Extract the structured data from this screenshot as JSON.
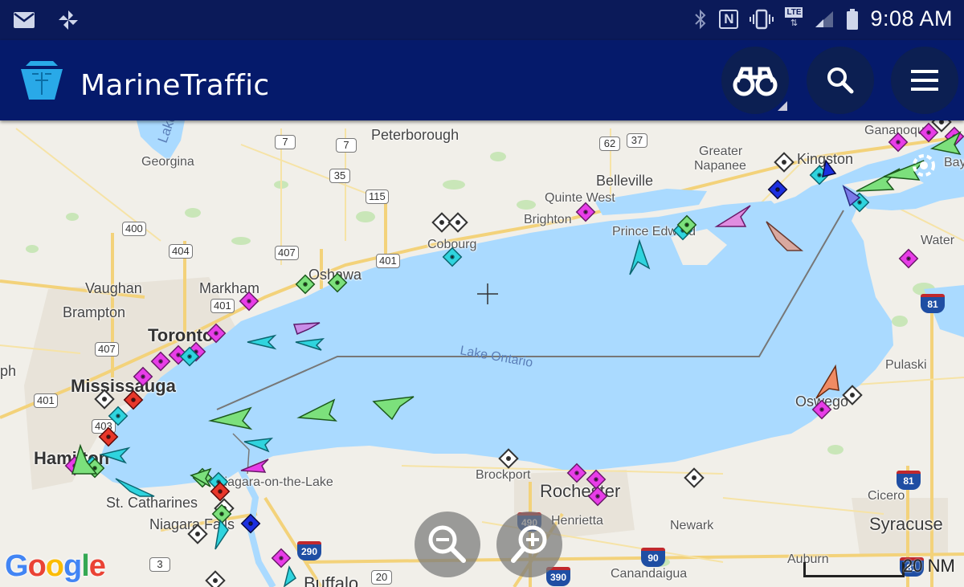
{
  "status_bar": {
    "time": "9:08 AM",
    "network": "LTE",
    "nfc": "N",
    "icons": [
      "mail-icon",
      "pinwheel-icon",
      "bluetooth-icon",
      "nfc-icon",
      "vibrate-icon",
      "lte-icon",
      "signal-icon",
      "battery-icon"
    ]
  },
  "app_bar": {
    "title": "MarineTraffic",
    "buttons": [
      "binoculars-icon",
      "search-icon",
      "menu-icon"
    ]
  },
  "map": {
    "water_body": "Lake Ontario",
    "lake_simcoe_label": "Lake",
    "places": [
      {
        "id": "peterborough",
        "name": "Peterborough"
      },
      {
        "id": "georgina",
        "name": "Georgina"
      },
      {
        "id": "gananoque",
        "name": "Gananoque"
      },
      {
        "id": "kingston",
        "name": "Kingston"
      },
      {
        "id": "bay",
        "name": "Bay"
      },
      {
        "id": "greater-napanee-1",
        "name": "Greater"
      },
      {
        "id": "greater-napanee-2",
        "name": "Napanee"
      },
      {
        "id": "belleville",
        "name": "Belleville"
      },
      {
        "id": "quinte-west",
        "name": "Quinte West"
      },
      {
        "id": "brighton",
        "name": "Brighton"
      },
      {
        "id": "cobourg",
        "name": "Cobourg"
      },
      {
        "id": "prince-edward",
        "name": "Prince Edward"
      },
      {
        "id": "watertown",
        "name": "Water"
      },
      {
        "id": "vaughan",
        "name": "Vaughan"
      },
      {
        "id": "markham",
        "name": "Markham"
      },
      {
        "id": "oshawa",
        "name": "Oshawa"
      },
      {
        "id": "brampton",
        "name": "Brampton"
      },
      {
        "id": "toronto",
        "name": "Toronto"
      },
      {
        "id": "mississauga",
        "name": "Mississauga"
      },
      {
        "id": "ph",
        "name": "ph"
      },
      {
        "id": "hamilton",
        "name": "Hamilton"
      },
      {
        "id": "pulaski",
        "name": "Pulaski"
      },
      {
        "id": "oswego",
        "name": "Oswego"
      },
      {
        "id": "st-catharines",
        "name": "St. Catharines"
      },
      {
        "id": "niagara-falls",
        "name": "Niagara Falls"
      },
      {
        "id": "niagara-on-the-lake",
        "name": "Niagara-on-the-Lake"
      },
      {
        "id": "brockport",
        "name": "Brockport"
      },
      {
        "id": "rochester",
        "name": "Rochester"
      },
      {
        "id": "henrietta",
        "name": "Henrietta"
      },
      {
        "id": "newark",
        "name": "Newark"
      },
      {
        "id": "cicero",
        "name": "Cicero"
      },
      {
        "id": "syracuse",
        "name": "Syracuse"
      },
      {
        "id": "auburn",
        "name": "Auburn"
      },
      {
        "id": "canandaigua",
        "name": "Canandaigua"
      },
      {
        "id": "buffalo",
        "name": "Buffalo"
      }
    ],
    "highway_shields": [
      "7",
      "7",
      "62",
      "37",
      "35",
      "115",
      "400",
      "404",
      "407",
      "401",
      "401",
      "407",
      "401",
      "403"
    ],
    "interstate_shields": [
      "81",
      "81",
      "490",
      "390",
      "90",
      "290",
      "81"
    ],
    "us_shields": [
      "3",
      "20",
      "20"
    ],
    "scale_label": "20 NM",
    "attribution": "Google",
    "zoom_out_label": "zoom-out-icon",
    "zoom_in_label": "zoom-in-icon",
    "vessel_colors": {
      "cargo": "#7ce07c",
      "tanker": "#e8372a",
      "passenger": "#2fd4de",
      "pleasure": "#e83de8",
      "tug": "#e8a0ff",
      "unknown": "#ffffff",
      "fishing": "#f08b63",
      "other": "#1c2fe0"
    }
  }
}
